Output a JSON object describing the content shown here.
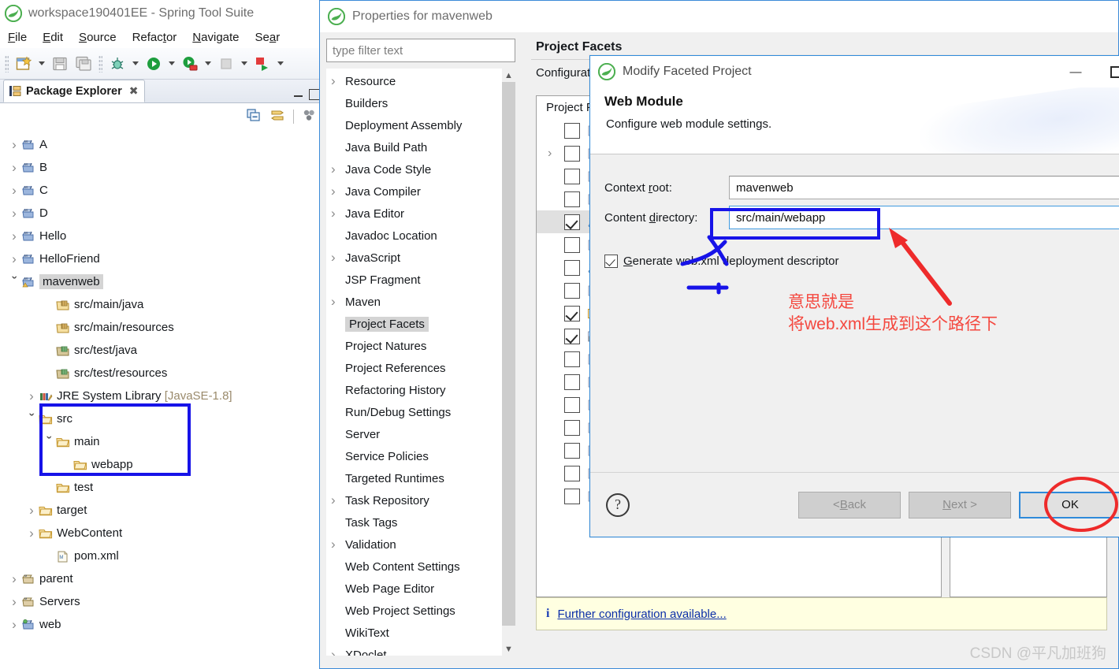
{
  "sts_window": {
    "title": "workspace190401EE - Spring Tool Suite",
    "logo_icon": "spring-leaf-icon",
    "menu": [
      {
        "label": "File",
        "accel": "F"
      },
      {
        "label": "Edit",
        "accel": "E"
      },
      {
        "label": "Source",
        "accel": "S"
      },
      {
        "label": "Refactor",
        "accel": "t"
      },
      {
        "label": "Navigate",
        "accel": "N"
      },
      {
        "label": "Sear",
        "accel": "a"
      }
    ],
    "toolbar": [
      {
        "icon": "new-wizard-icon",
        "dropdown": true
      },
      {
        "icon": "save-icon",
        "dropdown": false
      },
      {
        "icon": "save-all-icon",
        "dropdown": false
      },
      {
        "icon": "debug-icon",
        "dropdown": true
      },
      {
        "icon": "run-icon",
        "dropdown": true
      },
      {
        "icon": "run-server-icon",
        "dropdown": true
      },
      {
        "icon": "stop-icon",
        "dropdown": true
      },
      {
        "icon": "external-tools-icon",
        "dropdown": true
      }
    ],
    "view": {
      "tab_label": "Package Explorer",
      "close_icon": "close-icon",
      "collapse_all_icon": "collapse-all-icon",
      "link-with-editor-icon": "link-with-editor-icon",
      "view_menu_icon": "view-menu-icon",
      "minimize_icon": "minimize-icon",
      "maximize_icon": "maximize-icon"
    },
    "tree": [
      {
        "label": "A",
        "icon": "maven-project-icon",
        "indent": 0,
        "twist": "collapsed"
      },
      {
        "label": "B",
        "icon": "maven-project-icon",
        "indent": 0,
        "twist": "collapsed"
      },
      {
        "label": "C",
        "icon": "maven-project-icon",
        "indent": 0,
        "twist": "collapsed"
      },
      {
        "label": "D",
        "icon": "maven-project-icon",
        "indent": 0,
        "twist": "collapsed"
      },
      {
        "label": "Hello",
        "icon": "maven-project-icon",
        "indent": 0,
        "twist": "collapsed"
      },
      {
        "label": "HelloFriend",
        "icon": "maven-project-icon",
        "indent": 0,
        "twist": "collapsed"
      },
      {
        "label": "mavenweb",
        "icon": "maven-project-warning-icon",
        "indent": 0,
        "twist": "expanded",
        "selected": true
      },
      {
        "label": "src/main/java",
        "icon": "source-folder-icon",
        "indent": 2,
        "twist": "none"
      },
      {
        "label": "src/main/resources",
        "icon": "source-folder-icon",
        "indent": 2,
        "twist": "none"
      },
      {
        "label": "src/test/java",
        "icon": "test-source-folder-icon",
        "indent": 2,
        "twist": "none"
      },
      {
        "label": "src/test/resources",
        "icon": "test-source-folder-icon",
        "indent": 2,
        "twist": "none"
      },
      {
        "label": "JRE System Library ",
        "suffix": "[JavaSE-1.8]",
        "icon": "library-icon",
        "indent": 1,
        "twist": "collapsed"
      },
      {
        "label": "src",
        "icon": "folder-icon",
        "indent": 1,
        "twist": "expanded"
      },
      {
        "label": "main",
        "icon": "folder-icon",
        "indent": 2,
        "twist": "expanded"
      },
      {
        "label": "webapp",
        "icon": "folder-icon",
        "indent": 3,
        "twist": "none"
      },
      {
        "label": "test",
        "icon": "folder-icon",
        "indent": 2,
        "twist": "none"
      },
      {
        "label": "target",
        "icon": "folder-icon",
        "indent": 1,
        "twist": "collapsed"
      },
      {
        "label": "WebContent",
        "icon": "folder-icon",
        "indent": 1,
        "twist": "collapsed"
      },
      {
        "label": "pom.xml",
        "icon": "maven-pom-icon",
        "indent": 2,
        "twist": "none"
      },
      {
        "label": "parent",
        "icon": "project-icon",
        "indent": 0,
        "twist": "collapsed"
      },
      {
        "label": "Servers",
        "icon": "project-icon",
        "indent": 0,
        "twist": "collapsed"
      },
      {
        "label": "web",
        "icon": "web-project-icon",
        "indent": 0,
        "twist": "collapsed"
      }
    ]
  },
  "properties_dialog": {
    "title": "Properties for mavenweb",
    "logo_icon": "spring-leaf-icon",
    "filter": {
      "placeholder": "type filter text",
      "value": ""
    },
    "pages": [
      {
        "label": "Resource",
        "twist": "collapsed"
      },
      {
        "label": "Builders",
        "twist": "none"
      },
      {
        "label": "Deployment Assembly",
        "twist": "none"
      },
      {
        "label": "Java Build Path",
        "twist": "none"
      },
      {
        "label": "Java Code Style",
        "twist": "collapsed"
      },
      {
        "label": "Java Compiler",
        "twist": "collapsed"
      },
      {
        "label": "Java Editor",
        "twist": "collapsed"
      },
      {
        "label": "Javadoc Location",
        "twist": "none"
      },
      {
        "label": "JavaScript",
        "twist": "collapsed"
      },
      {
        "label": "JSP Fragment",
        "twist": "none"
      },
      {
        "label": "Maven",
        "twist": "collapsed"
      },
      {
        "label": "Project Facets",
        "twist": "none",
        "selected": true
      },
      {
        "label": "Project Natures",
        "twist": "none"
      },
      {
        "label": "Project References",
        "twist": "none"
      },
      {
        "label": "Refactoring History",
        "twist": "none"
      },
      {
        "label": "Run/Debug Settings",
        "twist": "none"
      },
      {
        "label": "Server",
        "twist": "none"
      },
      {
        "label": "Service Policies",
        "twist": "none"
      },
      {
        "label": "Targeted Runtimes",
        "twist": "none"
      },
      {
        "label": "Task Repository",
        "twist": "collapsed"
      },
      {
        "label": "Task Tags",
        "twist": "none"
      },
      {
        "label": "Validation",
        "twist": "collapsed"
      },
      {
        "label": "Web Content Settings",
        "twist": "none"
      },
      {
        "label": "Web Page Editor",
        "twist": "none"
      },
      {
        "label": "Web Project Settings",
        "twist": "none"
      },
      {
        "label": "WikiText",
        "twist": "none"
      },
      {
        "label": "XDoclet",
        "twist": "collapsed"
      }
    ],
    "scroll_up_icon": "chevron-up-icon",
    "scroll_down_icon": "chevron-down-icon",
    "page": {
      "title": "Project Facets",
      "description": "Configuration:",
      "list_header": "Project Facet",
      "facets": [
        {
          "checked": false,
          "twist": "none",
          "icon": "facet-icon"
        },
        {
          "checked": false,
          "twist": "collapsed",
          "icon": "facet-icon"
        },
        {
          "checked": false,
          "twist": "none",
          "icon": "facet-icon"
        },
        {
          "checked": false,
          "twist": "none",
          "icon": "facet-icon"
        },
        {
          "checked": true,
          "twist": "none",
          "icon": "java-facet-icon",
          "highlighted": true
        },
        {
          "checked": false,
          "twist": "none",
          "icon": "facet-icon"
        },
        {
          "checked": false,
          "twist": "none",
          "icon": "java-facet-icon"
        },
        {
          "checked": false,
          "twist": "none",
          "icon": "facet-icon"
        },
        {
          "checked": true,
          "twist": "none",
          "icon": "web-facet-icon"
        },
        {
          "checked": true,
          "twist": "none",
          "icon": "lock-facet-icon"
        },
        {
          "checked": false,
          "twist": "none",
          "icon": "facet-icon"
        },
        {
          "checked": false,
          "twist": "none",
          "icon": "facet-icon"
        },
        {
          "checked": false,
          "twist": "none",
          "icon": "facet-icon"
        },
        {
          "checked": false,
          "twist": "none",
          "icon": "facet-icon"
        },
        {
          "checked": false,
          "twist": "none",
          "icon": "facet-icon"
        },
        {
          "checked": false,
          "twist": "none",
          "icon": "facet-icon"
        },
        {
          "checked": false,
          "twist": "none",
          "icon": "facet-icon"
        }
      ]
    },
    "info_bar": {
      "icon": "info-icon",
      "link_text": "Further configuration available..."
    }
  },
  "modify_faceted_project_dialog": {
    "title": "Modify Faceted Project",
    "logo_icon": "spring-leaf-icon",
    "minimize_label": "—",
    "maximize_icon": "maximize-icon",
    "heading": "Web Module",
    "subheading": "Configure web module settings.",
    "fields": [
      {
        "label": "Context root:",
        "accel": "r",
        "value": "mavenweb",
        "name": "context-root"
      },
      {
        "label": "Content directory:",
        "accel": "d",
        "value": "src/main/webapp",
        "name": "content-directory"
      }
    ],
    "checkbox": {
      "label": "Generate web.xml deployment descriptor",
      "accel": "G",
      "checked": true
    },
    "buttons": {
      "help_icon": "help-icon",
      "back": "< Back",
      "next": "Next >",
      "ok": "OK"
    }
  },
  "annotations": {
    "chinese_line1": "意思就是",
    "chinese_line2": "将web.xml生成到这个路径下",
    "annotation_color": "#f4483f",
    "box_color": "#1713e8",
    "circle_color": "#ee2b2b",
    "watermark": "CSDN @平凡加班狗"
  }
}
